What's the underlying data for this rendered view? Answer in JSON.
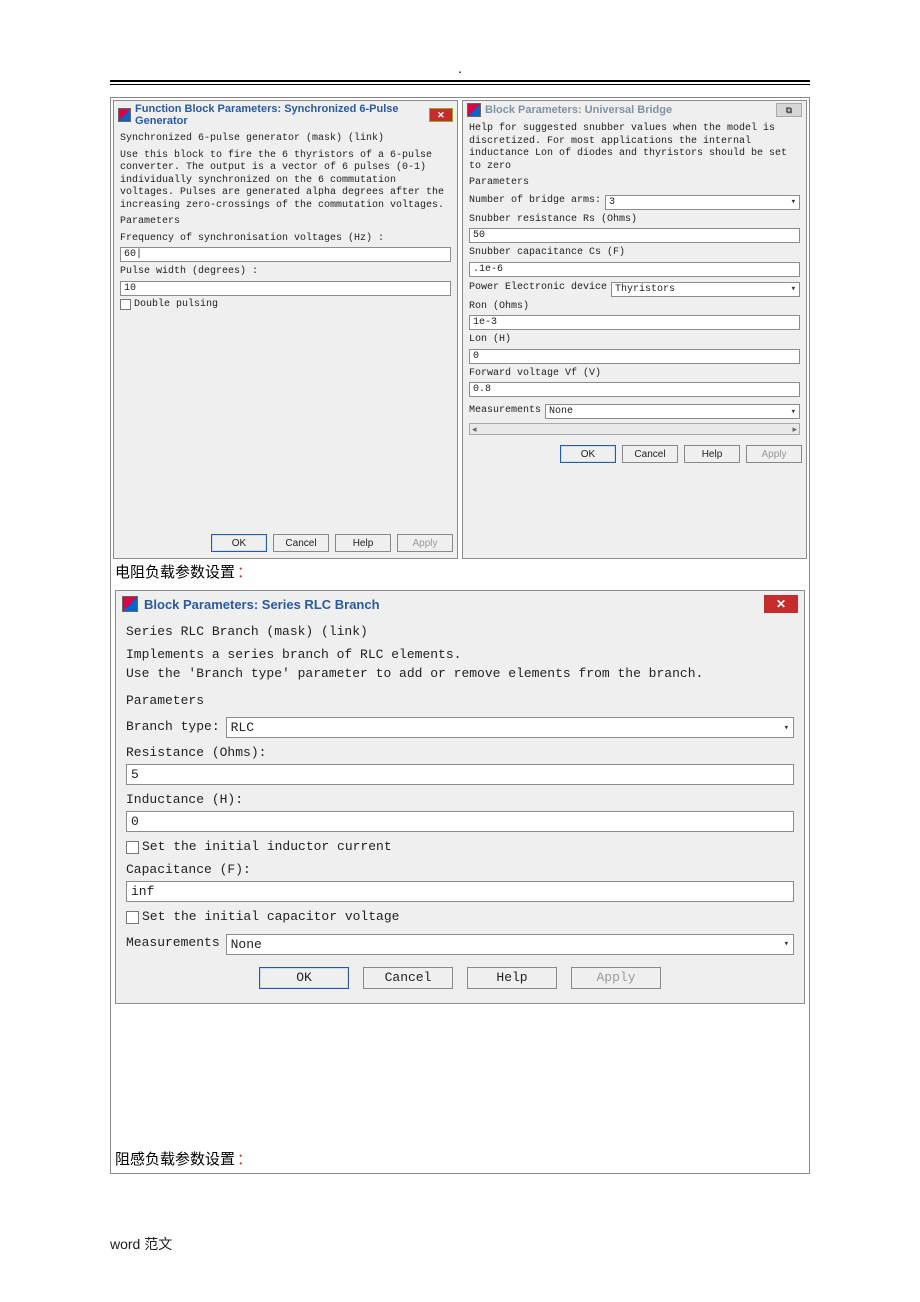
{
  "dialog1": {
    "title": "Function Block Parameters: Synchronized 6-Pulse Generator",
    "heading": "Synchronized 6-pulse generator (mask) (link)",
    "desc": "Use this block to fire the 6 thyristors of a 6-pulse converter. The output is a vector of 6 pulses (0-1) individually synchronized on the 6 commutation voltages. Pulses are generated alpha degrees after the increasing zero-crossings of the commutation voltages.",
    "parameters_label": "Parameters",
    "freq_label": "Frequency of synchronisation voltages (Hz) :",
    "freq_value": "60|",
    "pw_label": "Pulse width (degrees) :",
    "pw_value": "10",
    "double_pulsing": "Double pulsing",
    "buttons": {
      "ok": "OK",
      "cancel": "Cancel",
      "help": "Help",
      "apply": "Apply"
    }
  },
  "dialog2": {
    "title": "Block Parameters: Universal Bridge",
    "desc": "Help for suggested snubber values when the model is discretized. For most applications the internal inductance Lon of diodes and thyristors should be set to zero",
    "parameters_label": "Parameters",
    "bridgearms_label": "Number of bridge arms:",
    "bridgearms_value": "3",
    "rs_label": "Snubber resistance Rs (Ohms)",
    "rs_value": "50",
    "cs_label": "Snubber capacitance Cs (F)",
    "cs_value": ".1e-6",
    "ped_label": "Power Electronic device",
    "ped_value": "Thyristors",
    "ron_label": "Ron (Ohms)",
    "ron_value": "1e-3",
    "lon_label": "Lon (H)",
    "lon_value": "0",
    "vf_label": "Forward voltage Vf (V)",
    "vf_value": "0.8",
    "meas_label": "Measurements",
    "meas_value": "None",
    "buttons": {
      "ok": "OK",
      "cancel": "Cancel",
      "help": "Help",
      "apply": "Apply"
    }
  },
  "caption1": "电阻负载参数设置",
  "dialog3": {
    "title": "Block Parameters: Series RLC Branch",
    "heading": "Series RLC Branch (mask) (link)",
    "desc": "Implements a series branch of RLC elements.\nUse the 'Branch type' parameter to add or remove elements from the branch.",
    "parameters_label": "Parameters",
    "branchtype_label": "Branch type:",
    "branchtype_value": "RLC",
    "r_label": "Resistance (Ohms):",
    "r_value": "5",
    "l_label": "Inductance (H):",
    "l_value": "0",
    "set_l": "Set the initial inductor current",
    "c_label": "Capacitance (F):",
    "c_value": "inf",
    "set_c": "Set the initial capacitor voltage",
    "meas_label": "Measurements",
    "meas_value": "None",
    "buttons": {
      "ok": "OK",
      "cancel": "Cancel",
      "help": "Help",
      "apply": "Apply"
    }
  },
  "caption2": "阻感负载参数设置",
  "footer": "word 范文"
}
